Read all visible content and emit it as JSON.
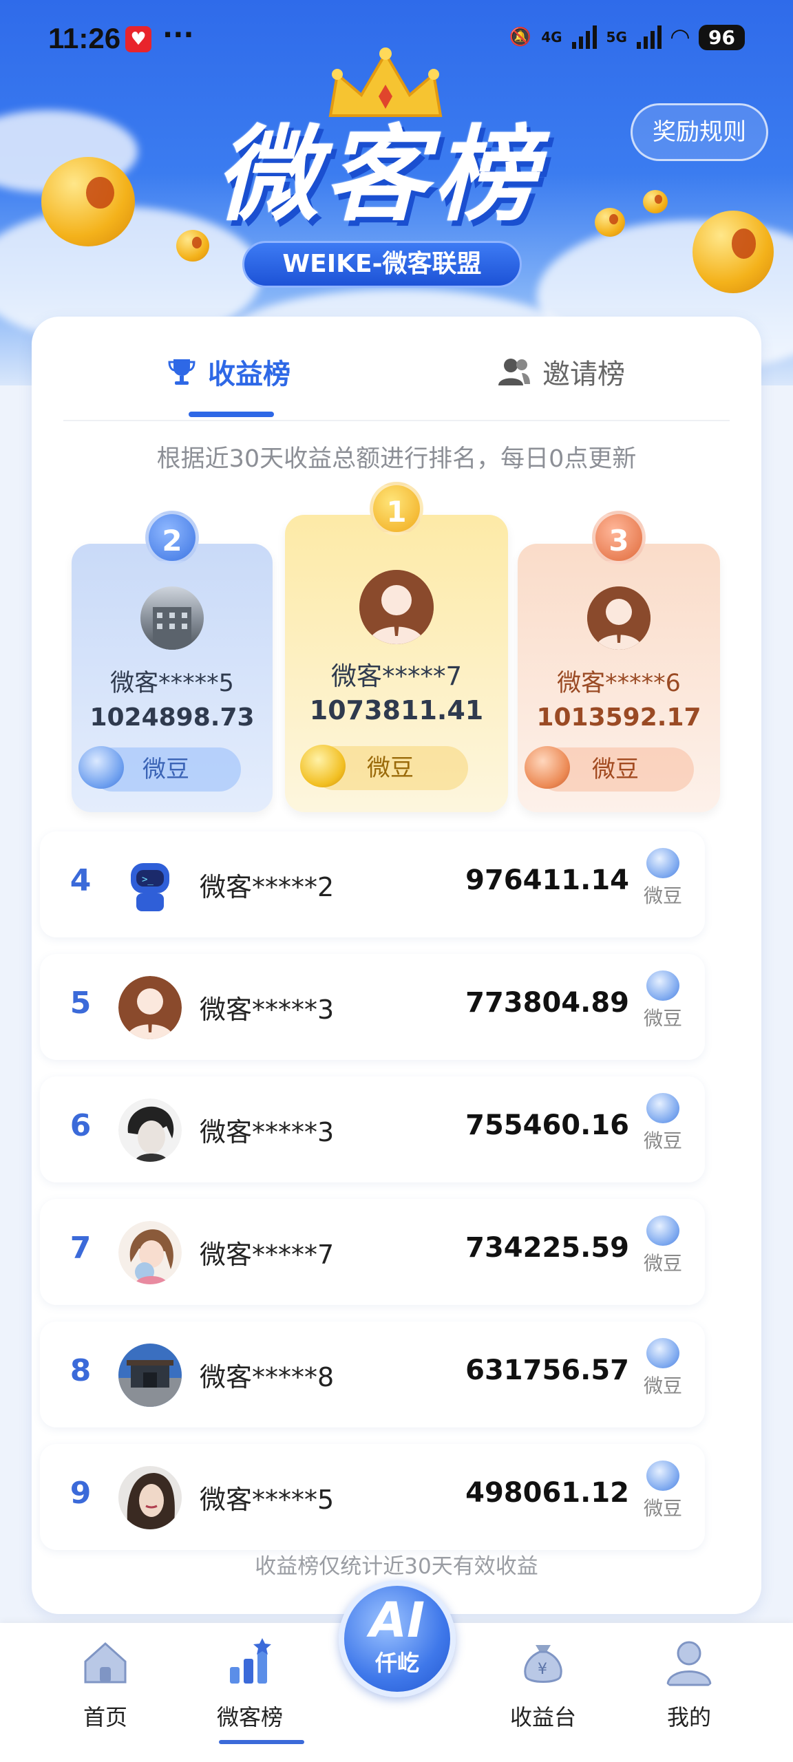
{
  "status_bar": {
    "time": "11:26",
    "dots": "···",
    "net1": "4G",
    "net2": "5G",
    "battery": "96"
  },
  "header": {
    "title": "微客榜",
    "subtitle": "WEIKE-微客联盟",
    "rules_button": "奖励规则"
  },
  "tabs": [
    {
      "label": "收益榜",
      "icon": "trophy-icon",
      "active": true
    },
    {
      "label": "邀请榜",
      "icon": "users-icon",
      "active": false
    }
  ],
  "description": "根据近30天收益总额进行排名，每日0点更新",
  "podium": [
    {
      "rank": "2",
      "name": "微客*****5",
      "value": "1024898.73",
      "unit": "微豆"
    },
    {
      "rank": "1",
      "name": "微客*****7",
      "value": "1073811.41",
      "unit": "微豆"
    },
    {
      "rank": "3",
      "name": "微客*****6",
      "value": "1013592.17",
      "unit": "微豆"
    }
  ],
  "ranking": [
    {
      "rank": "4",
      "name": "微客*****2",
      "value": "976411.14",
      "unit": "微豆"
    },
    {
      "rank": "5",
      "name": "微客*****3",
      "value": "773804.89",
      "unit": "微豆"
    },
    {
      "rank": "6",
      "name": "微客*****3",
      "value": "755460.16",
      "unit": "微豆"
    },
    {
      "rank": "7",
      "name": "微客*****7",
      "value": "734225.59",
      "unit": "微豆"
    },
    {
      "rank": "8",
      "name": "微客*****8",
      "value": "631756.57",
      "unit": "微豆"
    },
    {
      "rank": "9",
      "name": "微客*****5",
      "value": "498061.12",
      "unit": "微豆"
    }
  ],
  "footnote": "收益榜仅统计近30天有效收益",
  "bottom_nav": {
    "home": "首页",
    "rank": "微客榜",
    "ai_main": "AI",
    "ai_sub": "仟屹",
    "income": "收益台",
    "me": "我的"
  },
  "colors": {
    "primary": "#2e68e6",
    "gold": "#f0a91a",
    "bronze": "#9a4a24"
  }
}
